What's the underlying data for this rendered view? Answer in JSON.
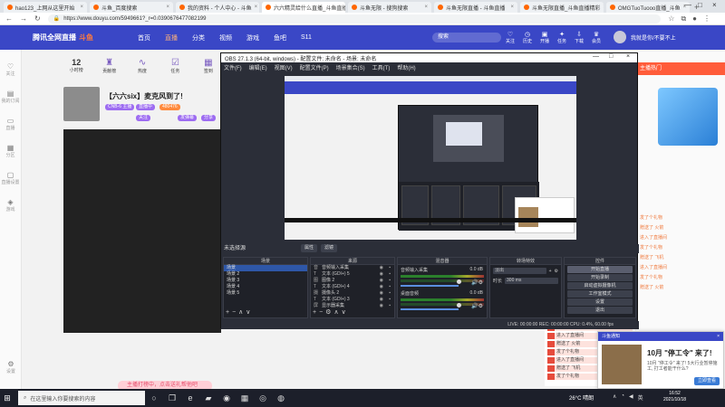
{
  "browser": {
    "tabs": [
      {
        "label": "hao123_上网从这里开始"
      },
      {
        "label": "斗鱼_百度搜索"
      },
      {
        "label": "我的资料 - 个人中心 - 斗鱼"
      },
      {
        "label": "六六精灵给什么直播_斗鱼直播"
      },
      {
        "label": "斗鱼无限 - 搜狗搜索"
      },
      {
        "label": "斗鱼无限直播 - 斗鱼直播"
      },
      {
        "label": "斗鱼无限直播_斗鱼直播精彩"
      },
      {
        "label": "OMGTuoTuooo直播_斗鱼"
      }
    ],
    "url": "https://www.douyu.com/5949661?_r=0.0390676477082199"
  },
  "douyu": {
    "logo": "腾讯全网直播",
    "logo_live": "斗鱼",
    "nav": [
      "首页",
      "直播",
      "分类",
      "视频",
      "游戏",
      "鱼吧",
      "S11"
    ],
    "search_placeholder": "搜索",
    "header_icons": [
      "关注",
      "历史",
      "开播",
      "任务",
      "下载",
      "会员"
    ],
    "username": "我就是你/不要不上",
    "rail": [
      "关注",
      "我的订阅",
      "直播",
      "分区",
      "直播设置",
      "游戏"
    ],
    "rail_bottom": "设置",
    "stats": [
      {
        "num": "12",
        "label": "小时榜"
      },
      {
        "num": "",
        "label": "贡献榜"
      },
      {
        "num": "",
        "label": "热度"
      },
      {
        "num": "",
        "label": "任务"
      },
      {
        "num": "",
        "label": "签到"
      }
    ],
    "anchor_title": "【六六six】麦克风到了!",
    "tags": [
      "CNB-6 主播",
      "直播中",
      "480476",
      "关注",
      "发弹幕",
      "分享"
    ],
    "right_top": "主播热门",
    "right_chat": [
      "发了个礼物",
      "赠送了 火箭",
      "进入了直播间",
      "发了个礼物",
      "赠送了 飞机",
      "进入了直播间",
      "发了个礼物",
      "赠送了 火箭"
    ],
    "red_rows": [
      "发了个礼物",
      "进入了直播间",
      "赠送了 火箭",
      "发了个礼物",
      "进入了直播间",
      "赠送了 飞机",
      "发了个礼物"
    ],
    "pink_bar": "主播打榜中，点击送礼帮他吧"
  },
  "obs": {
    "title": "OBS 27.1.3 (64-bit, windows) - 配置文件: 未命名 - 场景: 未命名",
    "menu": [
      "文件(F)",
      "编辑(E)",
      "视图(V)",
      "配置文件(P)",
      "场景集合(S)",
      "工具(T)",
      "帮助(H)"
    ],
    "source_bar_label": "未选择源",
    "properties_btn": "属性",
    "filters_btn": "滤镜",
    "docks": {
      "scenes": "场景",
      "sources": "来源",
      "mixer": "混音器",
      "transitions": "转场特效",
      "controls": "控件"
    },
    "scenes": [
      "场景",
      "场景 2",
      "场景 3",
      "场景 4",
      "场景 5"
    ],
    "sources": [
      {
        "icon": "音",
        "name": "音频输入采集"
      },
      {
        "icon": "T",
        "name": "文本 (GDI+) 5"
      },
      {
        "icon": "图",
        "name": "图像 2"
      },
      {
        "icon": "T",
        "name": "文本 (GDI+) 4"
      },
      {
        "icon": "摄",
        "name": "摄像头 2"
      },
      {
        "icon": "T",
        "name": "文本 (GDI+) 3"
      },
      {
        "icon": "屏",
        "name": "显示器采集"
      }
    ],
    "mixer": [
      {
        "name": "音频输入采集",
        "db": "0.0 dB"
      },
      {
        "name": "桌面音频",
        "db": "0.0 dB"
      }
    ],
    "transition": {
      "type": "淡出",
      "duration_label": "时长",
      "duration": "300 ms"
    },
    "controls": [
      "开始直播",
      "开始录制",
      "启动虚拟摄像机",
      "工作室模式",
      "设置",
      "退出"
    ],
    "status": "LIVE: 00:00:00   REC: 00:00:00   CPU: 0.4%, 60.00 fps"
  },
  "toast": {
    "header": "斗鱼通知",
    "title": "10月 \"停工令\" 来了!",
    "sub": "10月 \"停工令\" 来了! 5大行业暂停施工, 打工者能干什么?",
    "button": "立即查看"
  },
  "taskbar": {
    "search": "在这里输入你要搜索的内容",
    "weather": "26°C 晴朗",
    "time": "16:52",
    "date": "2021/10/18"
  }
}
